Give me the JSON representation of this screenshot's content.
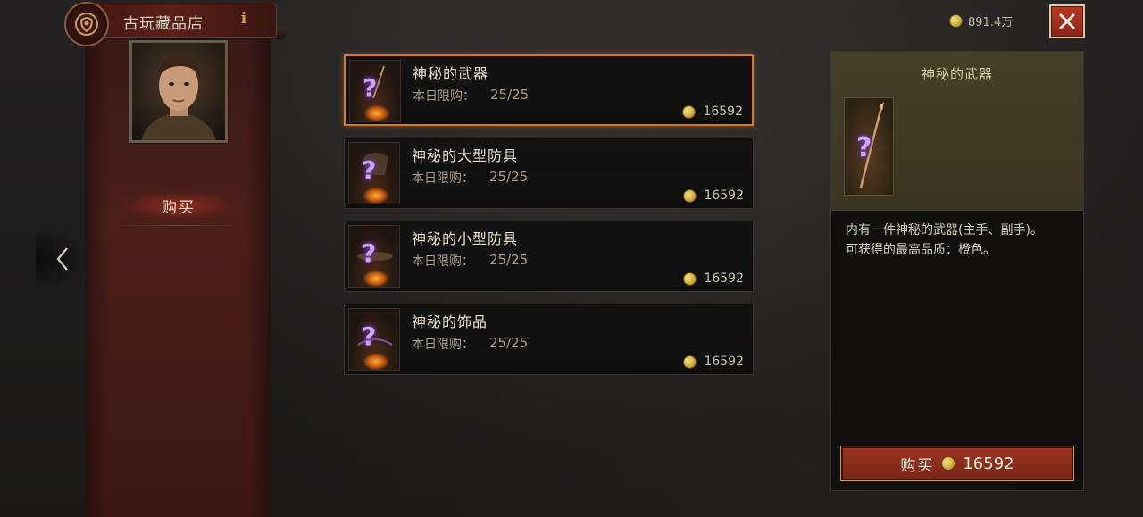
{
  "shop": {
    "title": "古玩藏品店",
    "info_glyph": "i",
    "emblem_icon": "shop-emblem-icon"
  },
  "sidebar": {
    "buy_tab_label": "购买",
    "nav_prev_icon": "chevron-left-icon"
  },
  "currency": {
    "gold": "891.4万",
    "coin_icon": "gold-coin-icon"
  },
  "close_icon": "close-icon",
  "items": [
    {
      "name": "神秘的武器",
      "limit_label": "本日限购：",
      "limit_value": "25/25",
      "price": "16592",
      "selected": true
    },
    {
      "name": "神秘的大型防具",
      "limit_label": "本日限购：",
      "limit_value": "25/25",
      "price": "16592",
      "selected": false
    },
    {
      "name": "神秘的小型防具",
      "limit_label": "本日限购：",
      "limit_value": "25/25",
      "price": "16592",
      "selected": false
    },
    {
      "name": "神秘的饰品",
      "limit_label": "本日限购：",
      "limit_value": "25/25",
      "price": "16592",
      "selected": false
    }
  ],
  "detail": {
    "title": "神秘的武器",
    "desc_line1": "内有一件神秘的武器(主手、副手)。",
    "desc_line2": "可获得的最高品质：橙色。",
    "buy_label": "购买",
    "buy_price": "16592"
  },
  "colors": {
    "accent_orange": "#d27a2a",
    "button_red": "#9a3420",
    "mystery_purple": "#c9a6f0"
  }
}
